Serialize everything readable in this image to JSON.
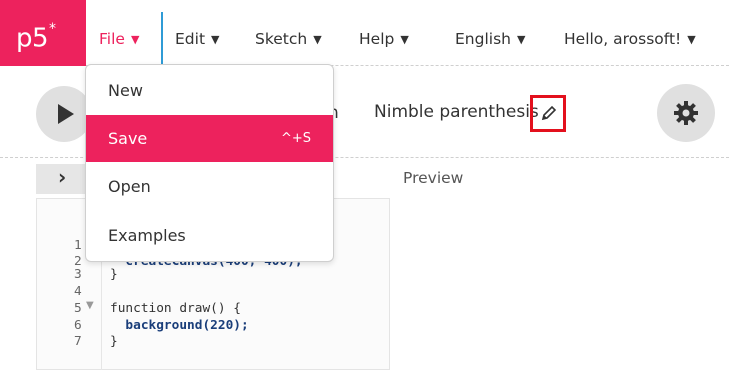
{
  "nav": {
    "logo": "p5",
    "logo_star": "*",
    "file": "File",
    "edit": "Edit",
    "sketch": "Sketch",
    "help": "Help",
    "language": "English",
    "user": "Hello, arossoft!"
  },
  "file_menu": {
    "items": [
      {
        "label": "New"
      },
      {
        "label": "Save",
        "shortcut": "^+S"
      },
      {
        "label": "Open"
      },
      {
        "label": "Examples"
      }
    ]
  },
  "toolbar": {
    "autorefresh_fragment": "h",
    "sketch_name": "Nimble parenthesis"
  },
  "editor": {
    "line_numbers": [
      "1",
      "2",
      "3",
      "4",
      "5",
      "6",
      "7"
    ],
    "lines": [
      "",
      "  createCanvas(400, 400);",
      "}",
      "",
      "function draw() {",
      "  background(220);",
      "}"
    ]
  },
  "preview": {
    "label": "Preview"
  },
  "colors": {
    "accent": "#ed225d",
    "highlight": "#e3101d"
  }
}
